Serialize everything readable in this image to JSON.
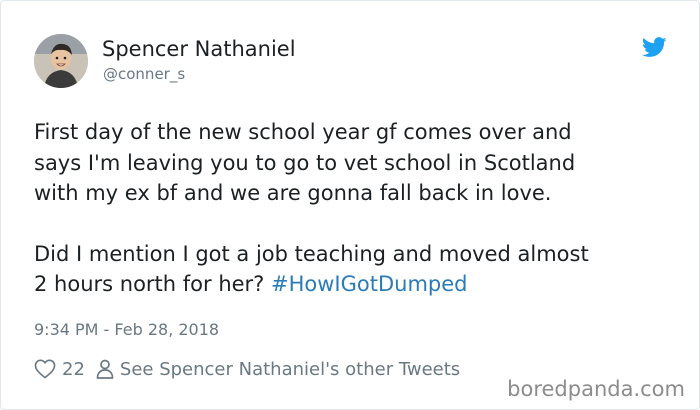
{
  "author": {
    "display_name": "Spencer Nathaniel",
    "handle": "@conner_s"
  },
  "tweet": {
    "lines_paragraph_1": [
      "First day of the new school year gf comes over and",
      "says I'm leaving you to go to vet school in Scotland",
      "with my ex bf and we are gonna fall back in love."
    ],
    "line_paragraph_2a": "Did I mention I got a job teaching and moved almost",
    "line_paragraph_2b": "2 hours north for her?",
    "hashtag": "#HowIGotDumped",
    "timestamp": "9:34 PM - Feb 28, 2018"
  },
  "actions": {
    "like_count": "22",
    "other_tweets_label": "See Spencer Nathaniel's other Tweets"
  },
  "watermark": "boredpanda.com",
  "colors": {
    "text": "#1c2022",
    "muted": "#697882",
    "link": "#2b7bb9",
    "twitter_blue": "#1da1f2"
  },
  "icons": {
    "brand": "twitter-bird-icon",
    "like": "heart-icon",
    "profile": "person-icon"
  }
}
